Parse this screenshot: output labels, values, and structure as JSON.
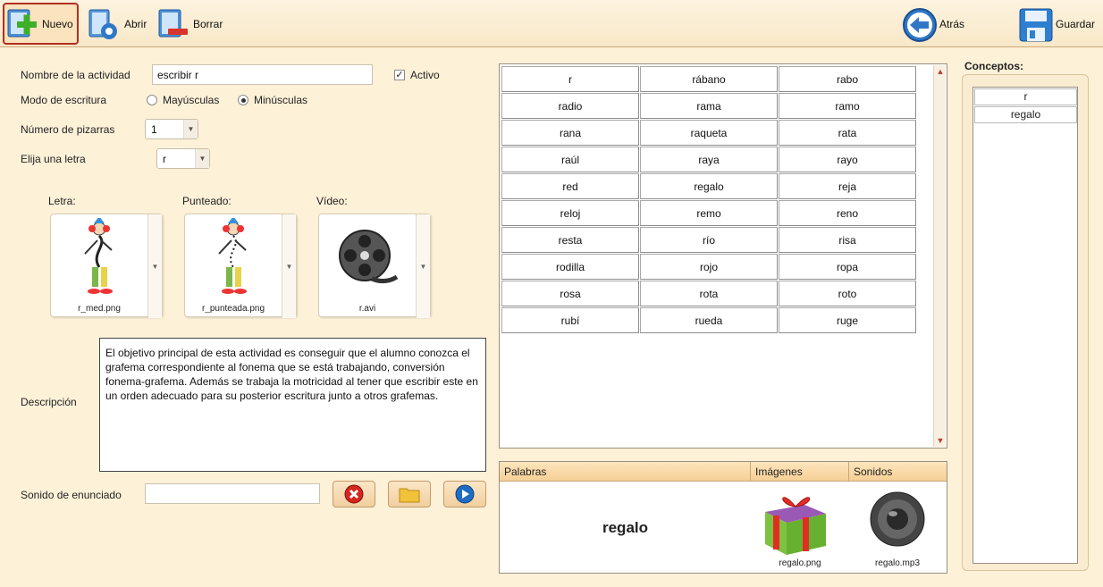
{
  "toolbar": {
    "new_label": "Nuevo",
    "open_label": "Abrir",
    "delete_label": "Borrar",
    "back_label": "Atrás",
    "save_label": "Guardar"
  },
  "form": {
    "activity_name_label": "Nombre de la actividad",
    "activity_name_value": "escribir r",
    "active_label": "Activo",
    "active_checked": true,
    "writing_mode_label": "Modo de escritura",
    "uppercase_label": "Mayúsculas",
    "lowercase_label": "Minúsculas",
    "selected_mode": "Minúsculas",
    "boards_label": "Número de pizarras",
    "boards_value": "1",
    "letter_label": "Elija una letra",
    "letter_value": "r"
  },
  "media": {
    "letter_title": "Letra:",
    "letter_file": "r_med.png",
    "dotted_title": "Punteado:",
    "dotted_file": "r_punteada.png",
    "video_title": "Vídeo:",
    "video_file": "r.avi"
  },
  "description": {
    "label": "Descripción",
    "text": "El objetivo principal de esta actividad es conseguir que el alumno conozca el grafema correspondiente al fonema que se está trabajando, conversión fonema-grafema. Además se trabaja la motricidad al tener que escribir este en un orden adecuado para su posterior escritura junto a otros grafemas."
  },
  "sound": {
    "label": "Sonido de enunciado",
    "value": ""
  },
  "words_grid": [
    [
      "r",
      "rábano",
      "rabo"
    ],
    [
      "radio",
      "rama",
      "ramo"
    ],
    [
      "rana",
      "raqueta",
      "rata"
    ],
    [
      "raúl",
      "raya",
      "rayo"
    ],
    [
      "red",
      "regalo",
      "reja"
    ],
    [
      "reloj",
      "remo",
      "reno"
    ],
    [
      "resta",
      "río",
      "risa"
    ],
    [
      "rodilla",
      "rojo",
      "ropa"
    ],
    [
      "rosa",
      "rota",
      "roto"
    ],
    [
      "rubí",
      "rueda",
      "ruge"
    ]
  ],
  "association": {
    "col_words": "Palabras",
    "col_images": "Imágenes",
    "col_sounds": "Sonidos",
    "word": "regalo",
    "image_file": "regalo.png",
    "sound_file": "regalo.mp3"
  },
  "concepts": {
    "title": "Conceptos:",
    "items": [
      "r",
      "regalo"
    ]
  },
  "colors": {
    "background": "#fdf1d8",
    "accent_red": "#c0392b",
    "header_orange": "#f6cf95"
  }
}
